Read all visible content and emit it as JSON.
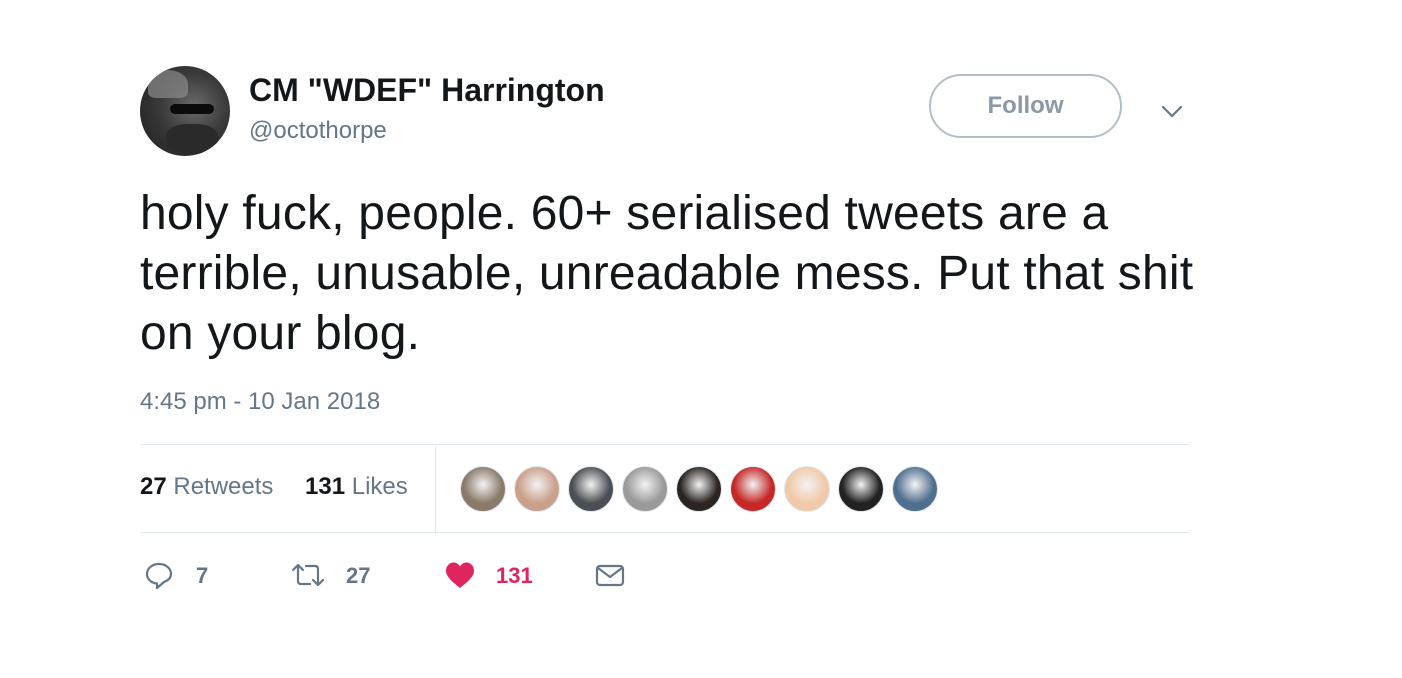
{
  "author": {
    "name": "CM \"WDEF\" Harrington",
    "handle": "@octothorpe"
  },
  "follow_label": "Follow",
  "tweet_text": "holy fuck, people. 60+ serialised tweets  are a terrible, unusable, unreadable mess. Put that shit on your blog.",
  "timestamp": "4:45 pm - 10 Jan 2018",
  "stats": {
    "retweets_count": "27",
    "retweets_label": "Retweets",
    "likes_count": "131",
    "likes_label": "Likes"
  },
  "likers": [
    {
      "color": "#8a7a6a"
    },
    {
      "color": "#c9a08a"
    },
    {
      "color": "#4a4f55"
    },
    {
      "color": "#9a9a9a"
    },
    {
      "color": "#2b2420"
    },
    {
      "color": "#c62828"
    },
    {
      "color": "#f1c9a8"
    },
    {
      "color": "#222222"
    },
    {
      "color": "#4f6f8f"
    }
  ],
  "actions": {
    "reply_count": "7",
    "retweet_count": "27",
    "like_count": "131"
  },
  "colors": {
    "like_active": "#e0245e",
    "muted": "#657786",
    "border": "#e1e8ed"
  },
  "icons": [
    "reply-icon",
    "retweet-icon",
    "heart-icon",
    "envelope-icon",
    "chevron-down-icon"
  ]
}
